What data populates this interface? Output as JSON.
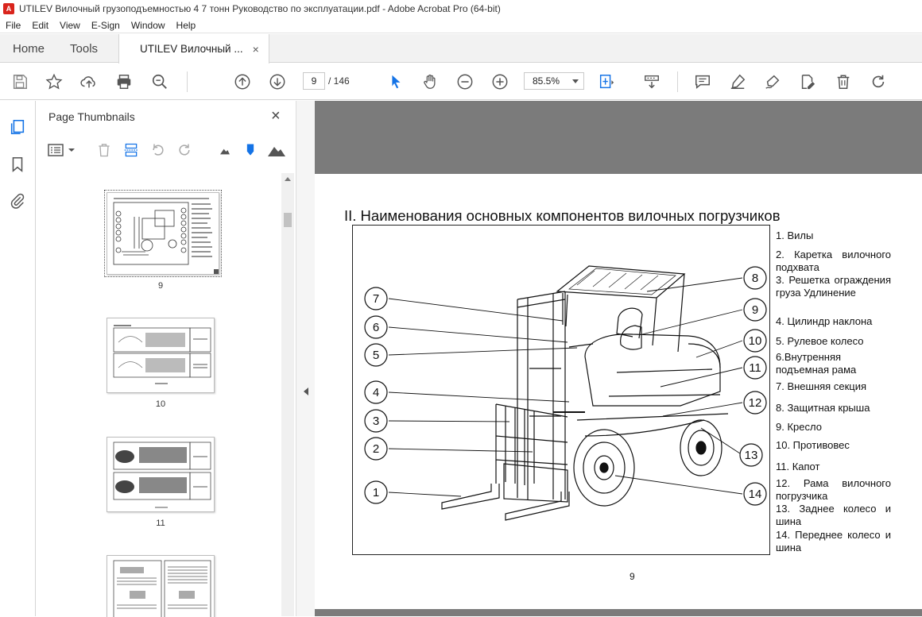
{
  "window": {
    "title": "UTILEV Вилочный грузоподъемностью 4 7 тонн Руководство по эксплуатации.pdf - Adobe Acrobat Pro (64-bit)"
  },
  "menu": [
    "File",
    "Edit",
    "View",
    "E-Sign",
    "Window",
    "Help"
  ],
  "tabs": {
    "home": "Home",
    "tools": "Tools",
    "document": "UTILEV Вилочный ...",
    "close": "×"
  },
  "toolbar": {
    "page_current": "9",
    "page_total": "/ 146",
    "zoom": "85.5%"
  },
  "panel": {
    "title": "Page Thumbnails",
    "close": "×"
  },
  "thumbnails": [
    {
      "num": "9",
      "selected": true
    },
    {
      "num": "10",
      "selected": false
    },
    {
      "num": "11",
      "selected": false
    },
    {
      "num": "",
      "selected": false
    }
  ],
  "page": {
    "heading": "II. Наименования основных компонентов вилочных погрузчиков",
    "number": "9",
    "legend": [
      "1. Вилы",
      "2. Каретка вилочного подхвата",
      "3. Решетка ограждения груза Удлинение",
      "4. Цилиндр наклона",
      "5. Рулевое колесо",
      "6.Внутренняя подъемная рама",
      "7. Внешняя секция",
      "8. Защитная крыша",
      "9. Кресло",
      "10. Противовес",
      "11. Капот",
      "12. Рама вилочного погрузчика",
      "13. Заднее колесо и шина",
      "14. Переднее колесо и шина"
    ],
    "callouts": [
      "1",
      "2",
      "3",
      "4",
      "5",
      "6",
      "7",
      "8",
      "9",
      "10",
      "11",
      "12",
      "13",
      "14"
    ]
  },
  "colors": {
    "accent": "#1473e6",
    "pdf_red": "#d9241c",
    "doc_bg": "#7b7b7b"
  },
  "icons": [
    "save-icon",
    "star-icon",
    "upload-icon",
    "print-icon",
    "zoom-search-icon",
    "arrow-up-icon",
    "arrow-down-icon",
    "pointer-icon",
    "hand-icon",
    "zoom-out-icon",
    "zoom-in-icon",
    "fit-page-icon",
    "scroll-mode-icon",
    "comment-icon",
    "highlight-icon",
    "sign-icon",
    "edit-icon",
    "delete-icon",
    "redo-icon"
  ]
}
